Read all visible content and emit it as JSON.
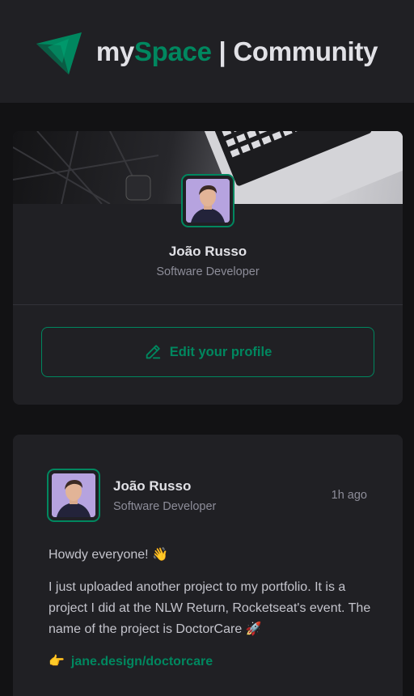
{
  "header": {
    "brand_prefix": "my",
    "brand_accent": "Space",
    "brand_suffix": " | Community",
    "accent_color": "#00875f"
  },
  "profile": {
    "name": "João Russo",
    "role": "Software Developer",
    "edit_label": "Edit your profile",
    "edit_icon": "pencil-icon"
  },
  "post": {
    "author": "João Russo",
    "role": "Software Developer",
    "time": "1h ago",
    "greeting": "Howdy everyone!",
    "greeting_emoji": "👋",
    "body": "I just uploaded another project to my portfolio. It is a project I did at the NLW Return, Rocketseat's event. The name of the project is DoctorCare",
    "body_emoji": "🚀",
    "link_emoji": "👉",
    "link": "jane.design/doctorcare"
  }
}
